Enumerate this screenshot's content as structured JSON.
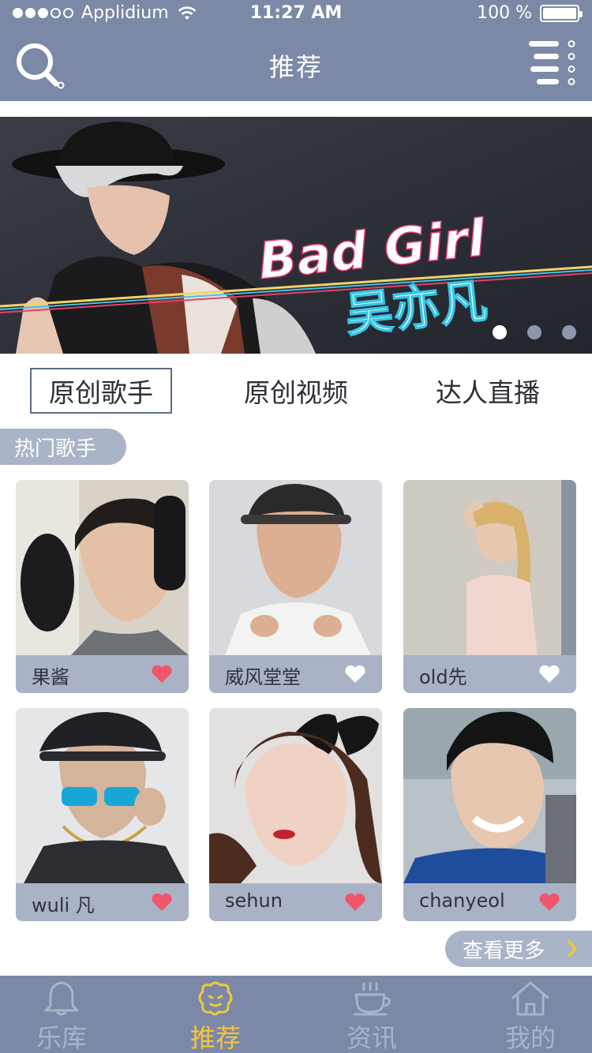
{
  "status_bar": {
    "carrier": "Applidium",
    "time": "11:27 AM",
    "battery": "100 %"
  },
  "header": {
    "title": "推荐",
    "search_icon": "search-icon",
    "menu_icon": "list-menu-icon"
  },
  "banner": {
    "active_index": 0,
    "slide_count": 3
  },
  "tabs": [
    {
      "label": "原创歌手",
      "active": true
    },
    {
      "label": "原创视频",
      "active": false
    },
    {
      "label": "达人直播",
      "active": false
    }
  ],
  "section": {
    "label": "热门歌手"
  },
  "singers": [
    {
      "name": "果酱",
      "liked": true
    },
    {
      "name": "威风堂堂",
      "liked": false
    },
    {
      "name": "old先",
      "liked": false
    },
    {
      "name": "wuli 凡",
      "liked": true
    },
    {
      "name": "sehun",
      "liked": true
    },
    {
      "name": "chanyeol",
      "liked": true
    }
  ],
  "more": {
    "label": "查看更多"
  },
  "bottom_nav": [
    {
      "label": "乐库",
      "icon": "bell-icon",
      "active": false
    },
    {
      "label": "推荐",
      "icon": "recommend-face-icon",
      "active": true
    },
    {
      "label": "资讯",
      "icon": "coffee-cup-icon",
      "active": false
    },
    {
      "label": "我的",
      "icon": "home-icon",
      "active": false
    }
  ],
  "colors": {
    "header_bg": "#7b89a6",
    "card_footer": "#aab3c6",
    "heart_liked": "#f0566b",
    "heart_unliked": "#ffffff",
    "nav_active": "#f5c53b",
    "nav_inactive": "#aab4c8"
  }
}
